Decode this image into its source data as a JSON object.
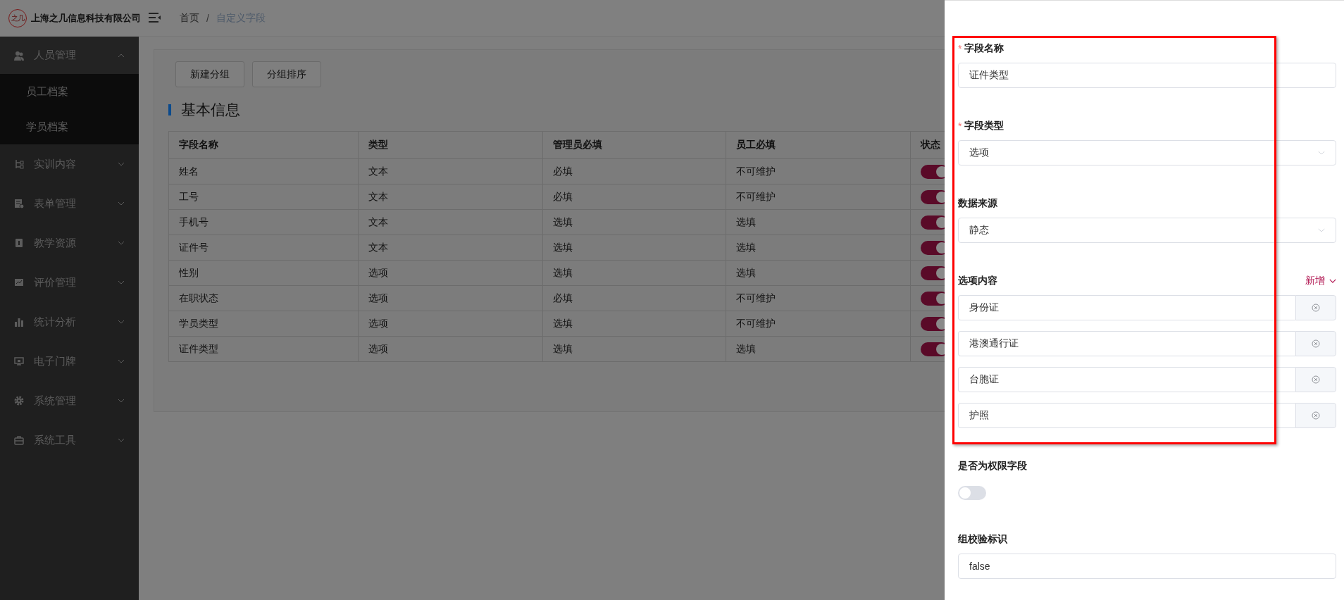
{
  "header": {
    "logo_text": "之几",
    "company": "上海之几信息科技有限公司",
    "separator": "/",
    "breadcrumb": [
      {
        "label": "首页",
        "current": false
      },
      {
        "label": "自定义字段",
        "current": true
      }
    ]
  },
  "sidebar": {
    "items": [
      {
        "label": "人员管理",
        "kind": "people",
        "expanded": true,
        "children": [
          {
            "label": "员工档案"
          },
          {
            "label": "学员档案"
          }
        ]
      },
      {
        "label": "实训内容",
        "kind": "tree",
        "expanded": false
      },
      {
        "label": "表单管理",
        "kind": "form",
        "expanded": false
      },
      {
        "label": "教学资源",
        "kind": "book",
        "expanded": false
      },
      {
        "label": "评价管理",
        "kind": "chart",
        "expanded": false
      },
      {
        "label": "统计分析",
        "kind": "bars",
        "expanded": false
      },
      {
        "label": "电子门牌",
        "kind": "monitor",
        "expanded": false
      },
      {
        "label": "系统管理",
        "kind": "gear",
        "expanded": false
      },
      {
        "label": "系统工具",
        "kind": "toolbox",
        "expanded": false
      }
    ]
  },
  "content": {
    "buttons": [
      "新建分组",
      "分组排序"
    ],
    "section_title": "基本信息",
    "table": {
      "columns": [
        "字段名称",
        "类型",
        "管理员必填",
        "员工必填",
        "状态"
      ],
      "rows": [
        {
          "cells": [
            "姓名",
            "文本",
            "必填",
            "不可维护"
          ],
          "enabled": true
        },
        {
          "cells": [
            "工号",
            "文本",
            "必填",
            "不可维护"
          ],
          "enabled": true
        },
        {
          "cells": [
            "手机号",
            "文本",
            "选填",
            "选填"
          ],
          "enabled": true
        },
        {
          "cells": [
            "证件号",
            "文本",
            "选填",
            "选填"
          ],
          "enabled": true
        },
        {
          "cells": [
            "性别",
            "选项",
            "选填",
            "选填"
          ],
          "enabled": true
        },
        {
          "cells": [
            "在职状态",
            "选项",
            "必填",
            "不可维护"
          ],
          "enabled": true
        },
        {
          "cells": [
            "学员类型",
            "选项",
            "选填",
            "不可维护"
          ],
          "enabled": true
        },
        {
          "cells": [
            "证件类型",
            "选项",
            "选填",
            "选填"
          ],
          "enabled": true
        }
      ]
    }
  },
  "drawer": {
    "fields": [
      {
        "kind": "input",
        "label": "字段名称",
        "required_mark": "*",
        "value": "证件类型"
      },
      {
        "kind": "select",
        "label": "字段类型",
        "required_mark": "*",
        "value": "选项"
      },
      {
        "kind": "select",
        "label": "数据来源",
        "value": "静态"
      },
      {
        "kind": "options",
        "label": "选项内容",
        "add_label": "新增",
        "options": [
          "身份证",
          "港澳通行证",
          "台胞证",
          "护照"
        ]
      },
      {
        "kind": "switch",
        "label": "是否为权限字段",
        "on": false
      },
      {
        "kind": "input",
        "label": "组校验标识",
        "value": "false"
      }
    ]
  }
}
